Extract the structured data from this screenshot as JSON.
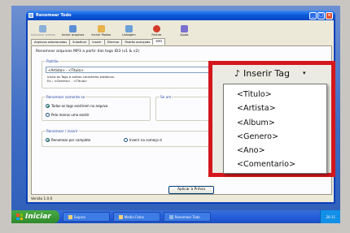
{
  "window": {
    "title": "Renomear Todo",
    "minimize": "_",
    "maximize": "□",
    "close": "×"
  },
  "toolbar": [
    {
      "label": "Adicionar pastas",
      "disabled": true,
      "color": "#8bb0d8"
    },
    {
      "label": "Incluir arquivos",
      "disabled": false,
      "color": "#5d8fd6"
    },
    {
      "label": "Incluir Pastas",
      "disabled": false,
      "color": "#e8b34a"
    },
    {
      "label": "Listagem",
      "disabled": false,
      "color": "#6aa0d8"
    },
    {
      "label": "Fechar",
      "disabled": false,
      "color": "#d43a2a"
    },
    {
      "label": "Ajuda",
      "disabled": false,
      "color": "#7b6fcf"
    }
  ],
  "tabs": [
    "Arquivos selecionados",
    "Substituir",
    "Inserir",
    "Eliminar",
    "Padrão avançado",
    "MP3"
  ],
  "mp3": {
    "heading": "Renomear arquivos MP3 a partir das tags ID3 (v1 & v2)",
    "padrao_label": "Padrão",
    "pattern_value": "<Artista> - <Titulo>",
    "hint_line1": "Insira as Tags e outros caracteres estáticos.",
    "hint_line2": "Ex.: <Genero> - <Titulo>",
    "somente_label": "Renomear somente se",
    "somente_opt1": "Todas as tags existirem no arquivo",
    "somente_opt2": "Pelo menos uma existir",
    "se_label": "Se um",
    "inserir_label": "Renomear / inserir",
    "inserir_opt1": "Renomear por completo",
    "inserir_opt2": "Inserir no começo d",
    "apply": "Aplicar à Prévia",
    "partial_ar": "ar"
  },
  "status": "Versão 1.0.0",
  "insert_tag": {
    "button_label": "Inserir Tag",
    "note_icon": "♪",
    "arrow": "▾",
    "items": [
      "<Titulo>",
      "<Artista>",
      "<Album>",
      "<Genero>",
      "<Ano>",
      "<Comentario>"
    ]
  },
  "taskbar": {
    "start": "Iniciar",
    "tasks": [
      "Separa",
      "Media Fotos",
      "Renomear Todo"
    ],
    "clock": "20:11"
  }
}
